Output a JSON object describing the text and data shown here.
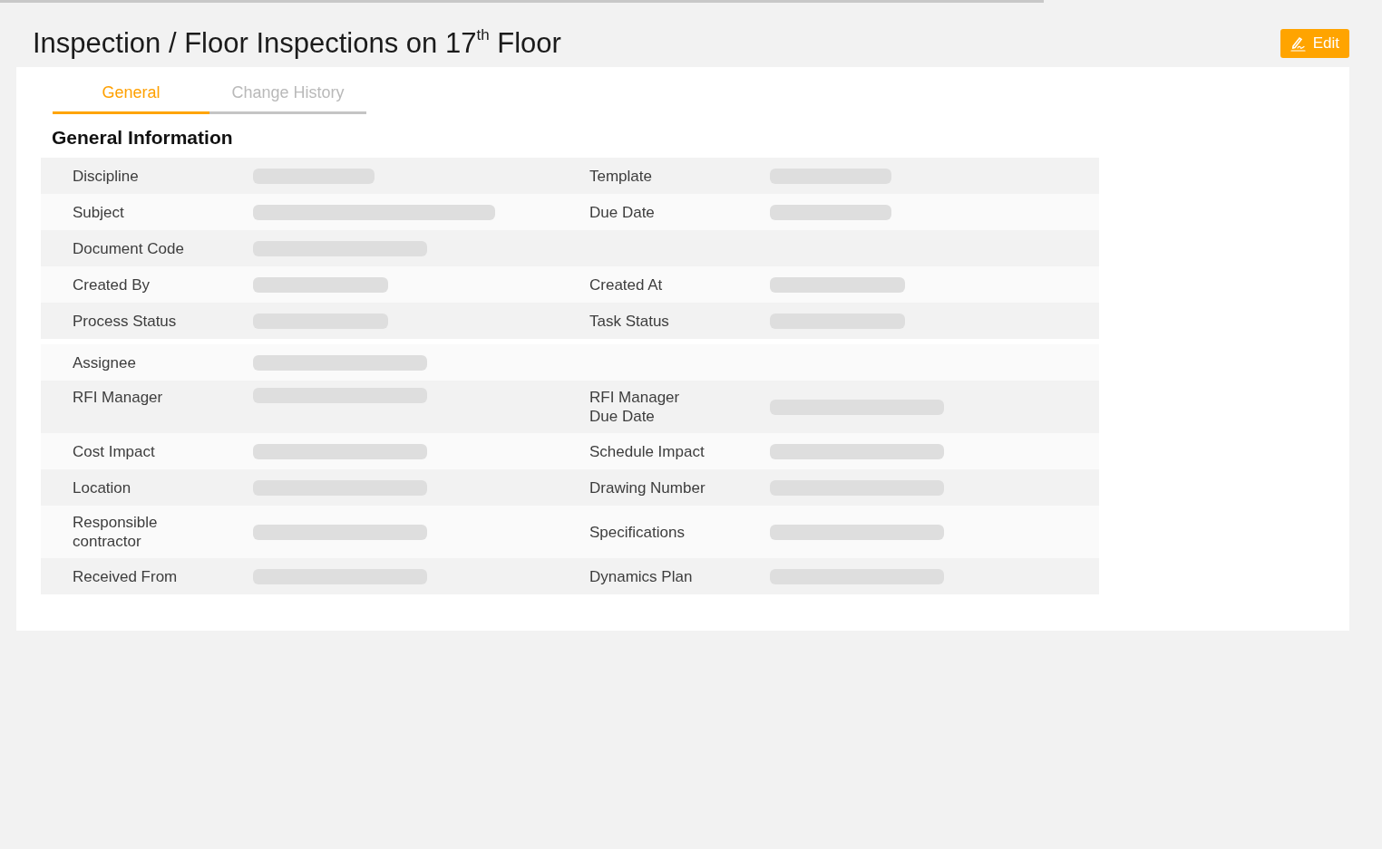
{
  "loading_bar": {
    "level": 0.755
  },
  "header": {
    "title": "Inspection / Floor Inspections on 17$^{th}$ Floor",
    "edit_button": "Edit"
  },
  "tabs": [
    {
      "label": "General",
      "selected": true
    },
    {
      "label": "Change History",
      "selected": false
    }
  ],
  "section": {
    "title": "General Information"
  },
  "rows": [
    {
      "cells": [
        {
          "label": "Discipline"
        },
        {
          "label": "Template"
        }
      ]
    },
    {
      "cells": [
        {
          "label": "Subject"
        },
        {
          "label": "Due Date"
        }
      ]
    },
    {
      "cells": [
        {
          "label": "Document Code"
        }
      ]
    },
    {
      "cells": [
        {
          "label": "Created By"
        },
        {
          "label": "Created At"
        }
      ]
    },
    {
      "cells": [
        {
          "label": "Process Status"
        },
        {
          "label": "Task Status"
        }
      ]
    },
    {
      "cells": [
        {
          "label": "Assignee"
        }
      ]
    },
    {
      "cells": [
        {
          "label": "RFI Manager"
        },
        {
          "label": "RFI Manager\nDue Date"
        }
      ]
    },
    {
      "cells": [
        {
          "label": "Cost Impact"
        },
        {
          "label": "Schedule Impact"
        }
      ]
    },
    {
      "cells": [
        {
          "label": "Location"
        },
        {
          "label": "Drawing Number"
        }
      ]
    },
    {
      "cells": [
        {
          "label": "Responsible\ncontractor"
        },
        {
          "label": "Specifications"
        }
      ]
    },
    {
      "cells": [
        {
          "label": "Received From"
        },
        {
          "label": "Dynamics Plan"
        }
      ]
    }
  ]
}
